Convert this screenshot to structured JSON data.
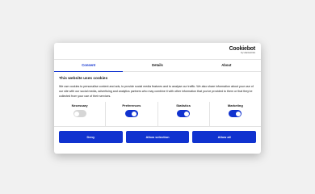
{
  "logo": {
    "name": "Cookiebot",
    "sub": "by Usercentrics"
  },
  "tabs": [
    {
      "label": "Consent",
      "active": true
    },
    {
      "label": "Details",
      "active": false
    },
    {
      "label": "About",
      "active": false
    }
  ],
  "title": "This website uses cookies",
  "description": "We use cookies to personalise content and ads, to provide social media features and to analyse our traffic. We also share information about your use of our site with our social media, advertising and analytics partners who may combine it with other information that you've provided to them or that they've collected from your use of their services.",
  "categories": [
    {
      "label": "Necessary",
      "enabled": true,
      "locked": true
    },
    {
      "label": "Preferences",
      "enabled": true
    },
    {
      "label": "Statistics",
      "enabled": true
    },
    {
      "label": "Marketing",
      "enabled": true
    }
  ],
  "buttons": {
    "deny": "Deny",
    "allow_selection": "Allow selection",
    "allow_all": "Allow all"
  },
  "colors": {
    "accent": "#1032cf",
    "disabled_toggle": "#d6d6d6",
    "backdrop": "#f1f1f1"
  }
}
